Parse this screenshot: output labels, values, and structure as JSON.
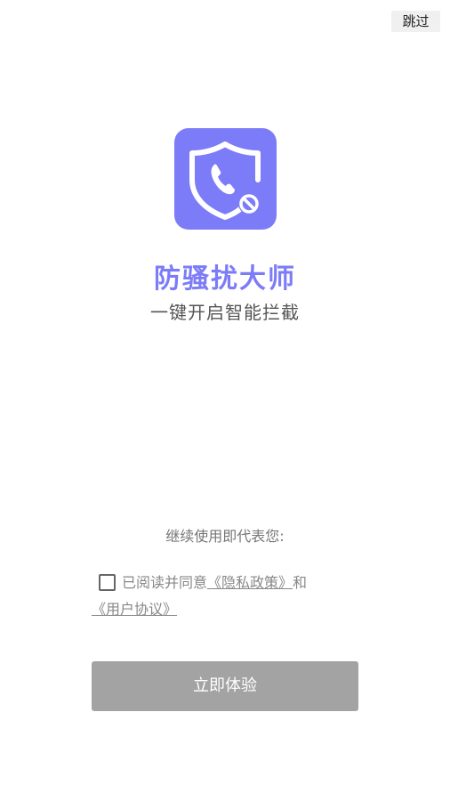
{
  "header": {
    "skip_label": "跳过"
  },
  "brand": {
    "logo_icon": "shield-phone-block-icon",
    "app_name": "防骚扰大师",
    "slogan": "一键开启智能拦截",
    "accent_color": "#7c7cf8"
  },
  "consent": {
    "intro_text": "继续使用即代表您:",
    "agree_prefix": "已阅读并同意",
    "privacy_link": "《隐私政策》",
    "and_text": "和",
    "terms_link": "《用户协议》",
    "checked": false
  },
  "footer": {
    "start_label": "立即体验",
    "button_color": "#a3a3a3"
  }
}
